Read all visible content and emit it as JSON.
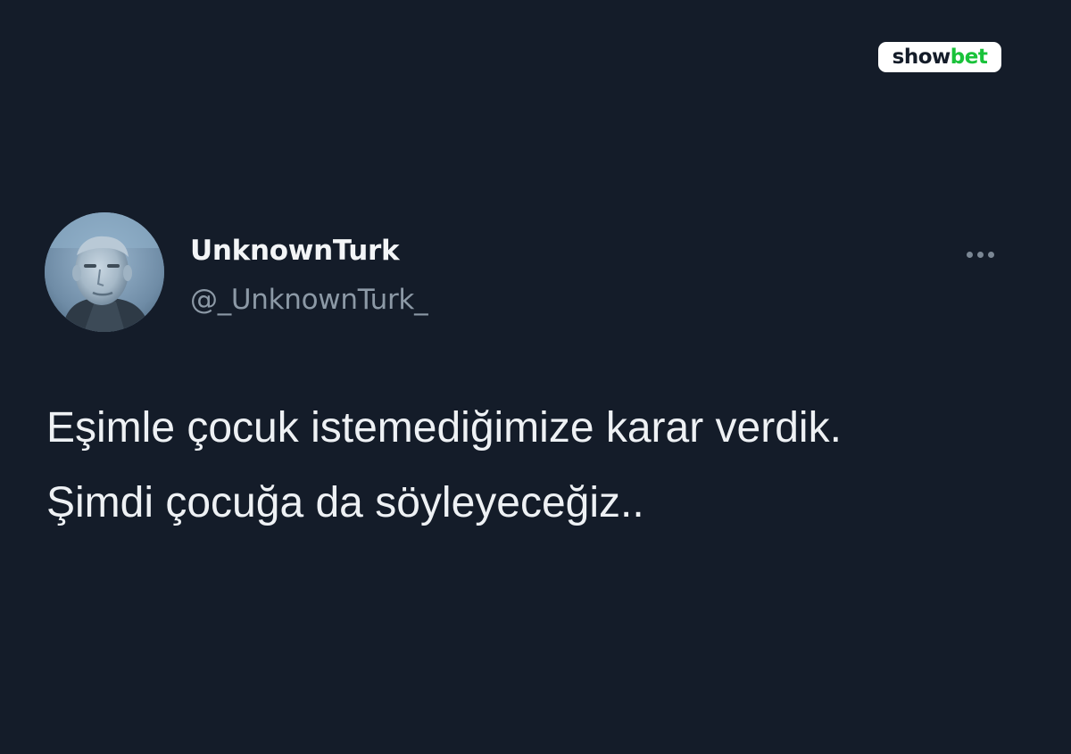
{
  "watermark": {
    "part1": "show",
    "part2": "bet",
    "colors": {
      "part1": "#141c29",
      "part2": "#19c23a",
      "background": "#ffffff"
    }
  },
  "tweet": {
    "author": {
      "display_name": "UnknownTurk",
      "handle": "@_UnknownTurk_",
      "avatar_icon": "profile-photo"
    },
    "menu_icon": "more-horizontal-icon",
    "text_lines": [
      "Eşimle çocuk istemediğimize karar verdik.",
      "Şimdi çocuğa da söyleyeceğiz.."
    ]
  },
  "colors": {
    "background": "#141c29",
    "text_primary": "#eef1f4",
    "text_secondary": "#8c99a6"
  }
}
